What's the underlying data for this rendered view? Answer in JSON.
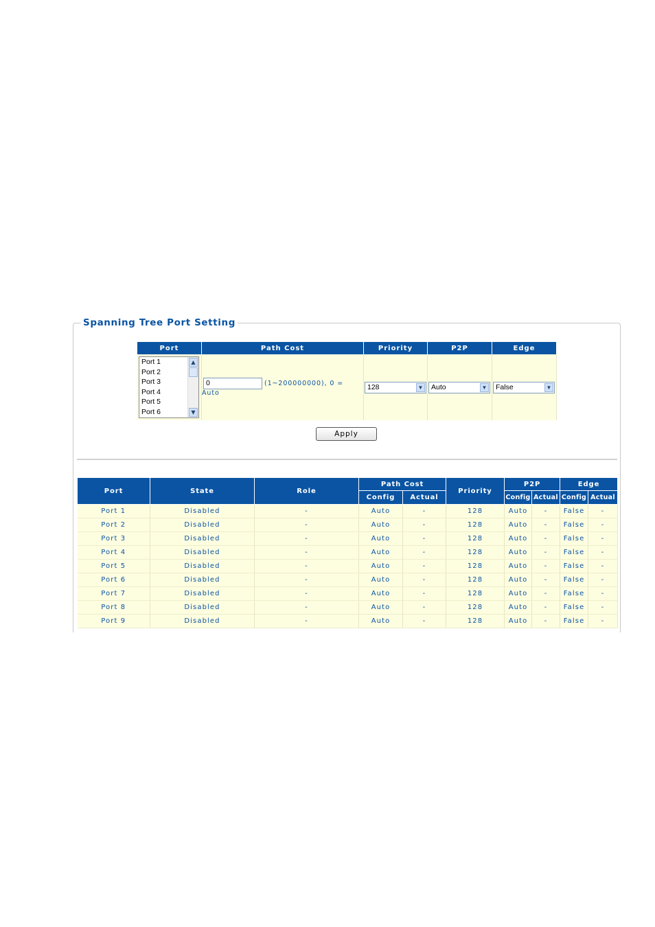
{
  "section_title": "Spanning Tree Port Setting",
  "setting": {
    "headers": {
      "port": "Port",
      "path_cost": "Path Cost",
      "priority": "Priority",
      "p2p": "P2P",
      "edge": "Edge"
    },
    "port_list": [
      "Port 1",
      "Port 2",
      "Port 3",
      "Port 4",
      "Port 5",
      "Port 6"
    ],
    "path_cost_value": "0",
    "path_cost_note": "(1~200000000), 0 = Auto",
    "priority_selected": "128",
    "p2p_selected": "Auto",
    "edge_selected": "False",
    "apply_label": "Apply"
  },
  "status": {
    "headers": {
      "port": "Port",
      "state": "State",
      "role": "Role",
      "path_cost": "Path Cost",
      "priority": "Priority",
      "p2p": "P2P",
      "edge": "Edge",
      "config": "Config",
      "actual": "Actual"
    },
    "rows": [
      {
        "port": "Port 1",
        "state": "Disabled",
        "role": "-",
        "pc_config": "Auto",
        "pc_actual": "-",
        "priority": "128",
        "p2p_config": "Auto",
        "p2p_actual": "-",
        "edge_config": "False",
        "edge_actual": "-"
      },
      {
        "port": "Port 2",
        "state": "Disabled",
        "role": "-",
        "pc_config": "Auto",
        "pc_actual": "-",
        "priority": "128",
        "p2p_config": "Auto",
        "p2p_actual": "-",
        "edge_config": "False",
        "edge_actual": "-"
      },
      {
        "port": "Port 3",
        "state": "Disabled",
        "role": "-",
        "pc_config": "Auto",
        "pc_actual": "-",
        "priority": "128",
        "p2p_config": "Auto",
        "p2p_actual": "-",
        "edge_config": "False",
        "edge_actual": "-"
      },
      {
        "port": "Port 4",
        "state": "Disabled",
        "role": "-",
        "pc_config": "Auto",
        "pc_actual": "-",
        "priority": "128",
        "p2p_config": "Auto",
        "p2p_actual": "-",
        "edge_config": "False",
        "edge_actual": "-"
      },
      {
        "port": "Port 5",
        "state": "Disabled",
        "role": "-",
        "pc_config": "Auto",
        "pc_actual": "-",
        "priority": "128",
        "p2p_config": "Auto",
        "p2p_actual": "-",
        "edge_config": "False",
        "edge_actual": "-"
      },
      {
        "port": "Port 6",
        "state": "Disabled",
        "role": "-",
        "pc_config": "Auto",
        "pc_actual": "-",
        "priority": "128",
        "p2p_config": "Auto",
        "p2p_actual": "-",
        "edge_config": "False",
        "edge_actual": "-"
      },
      {
        "port": "Port 7",
        "state": "Disabled",
        "role": "-",
        "pc_config": "Auto",
        "pc_actual": "-",
        "priority": "128",
        "p2p_config": "Auto",
        "p2p_actual": "-",
        "edge_config": "False",
        "edge_actual": "-"
      },
      {
        "port": "Port 8",
        "state": "Disabled",
        "role": "-",
        "pc_config": "Auto",
        "pc_actual": "-",
        "priority": "128",
        "p2p_config": "Auto",
        "p2p_actual": "-",
        "edge_config": "False",
        "edge_actual": "-"
      },
      {
        "port": "Port 9",
        "state": "Disabled",
        "role": "-",
        "pc_config": "Auto",
        "pc_actual": "-",
        "priority": "128",
        "p2p_config": "Auto",
        "p2p_actual": "-",
        "edge_config": "False",
        "edge_actual": "-"
      }
    ]
  },
  "colors": {
    "header_blue": "#0a54a3",
    "row_yellow": "#fdfde0",
    "link_text": "#0a54a3"
  },
  "icons": {
    "scroll_up": "chevron-up-icon",
    "scroll_down": "chevron-down-icon",
    "dropdown": "chevron-down-icon"
  }
}
